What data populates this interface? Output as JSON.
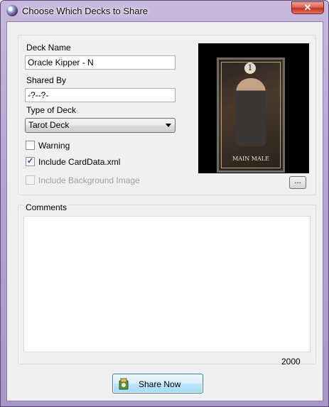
{
  "window": {
    "title": "Choose Which Decks to Share",
    "close_symbol": "✕"
  },
  "form": {
    "deck_name_label": "Deck Name",
    "deck_name_value": "Oracle Kipper - N",
    "shared_by_label": "Shared By",
    "shared_by_value": "-?--?-",
    "type_label": "Type of Deck",
    "type_value": "Tarot Deck",
    "warning_label": "Warning",
    "warning_checked": false,
    "include_carddata_label": "Include CardData.xml",
    "include_carddata_checked": true,
    "include_background_label": "Include Background Image",
    "include_background_enabled": false
  },
  "preview": {
    "card_number": "1",
    "card_caption": "MAIN MALE",
    "browse_label": "..."
  },
  "comments": {
    "label": "Comments",
    "value": "",
    "char_limit": "2000"
  },
  "actions": {
    "share_label": "Share Now"
  },
  "icons": {
    "app": "app-icon",
    "close": "close-icon",
    "dropdown": "chevron-down-icon",
    "share": "share-icon"
  }
}
